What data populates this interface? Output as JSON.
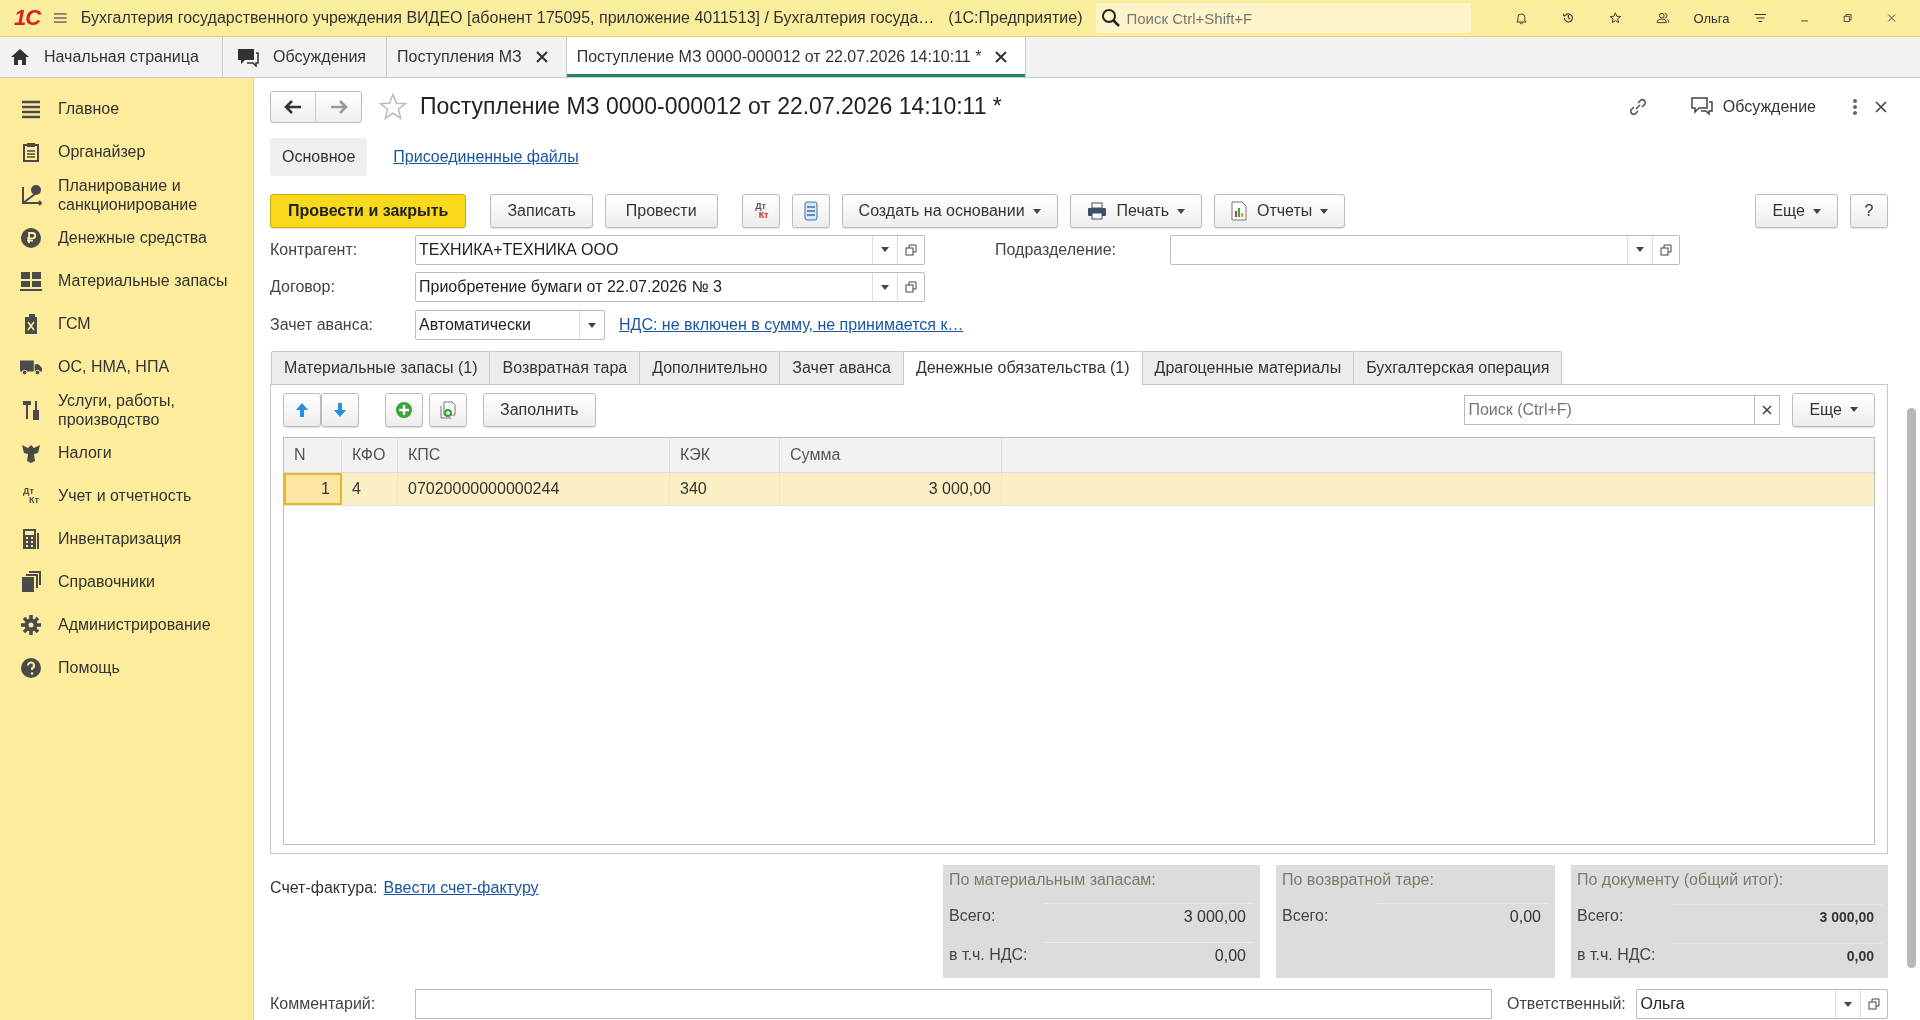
{
  "window": {
    "logo": "1С",
    "title": "Бухгалтерия государственного учреждения ВИДЕО [абонент 175095, приложение 4011513] / Бухгалтерия госуда…",
    "app_name": "(1С:Предприятие)",
    "search_placeholder": "Поиск Ctrl+Shift+F",
    "user": "Ольга"
  },
  "open_tabs": [
    {
      "label": "Начальная страница",
      "kind": "home",
      "selected": false,
      "closable": false
    },
    {
      "label": "Обсуждения",
      "kind": "discussions",
      "selected": false,
      "closable": false
    },
    {
      "label": "Поступления МЗ",
      "kind": "list",
      "selected": false,
      "closable": true
    },
    {
      "label": "Поступление МЗ 0000-000012 от 22.07.2026 14:10:11 *",
      "kind": "document",
      "selected": true,
      "closable": true
    }
  ],
  "sidebar": {
    "items": [
      {
        "label": "Главное"
      },
      {
        "label": "Органайзер"
      },
      {
        "label": "Планирование и санкционирование"
      },
      {
        "label": "Денежные средства"
      },
      {
        "label": "Материальные запасы"
      },
      {
        "label": "ГСМ"
      },
      {
        "label": "ОС, НМА, НПА"
      },
      {
        "label": "Услуги, работы, производство"
      },
      {
        "label": "Налоги"
      },
      {
        "label": "Учет и отчетность",
        "icon_text": [
          "Дт",
          "Кт"
        ]
      },
      {
        "label": "Инвентаризация"
      },
      {
        "label": "Справочники"
      },
      {
        "label": "Администрирование"
      },
      {
        "label": "Помощь"
      }
    ]
  },
  "document": {
    "title": "Поступление МЗ 0000-000012 от 22.07.2026 14:10:11 *",
    "favorite": false,
    "discussion": "Обсуждение",
    "form_tabs": [
      {
        "label": "Основное",
        "selected": true
      },
      {
        "label": "Присоединенные файлы",
        "selected": false
      }
    ],
    "toolbar": [
      {
        "label": "Провести и закрыть",
        "kind": "primary"
      },
      {
        "label": "Записать",
        "kind": "plain"
      },
      {
        "label": "Провести",
        "kind": "plain"
      },
      {
        "kind": "dtkt",
        "icon_text": [
          "Дт",
          "Кт"
        ]
      },
      {
        "kind": "list"
      },
      {
        "label": "Создать на основании",
        "kind": "dropdown"
      },
      {
        "label": "Печать",
        "kind": "print"
      },
      {
        "label": "Отчеты",
        "kind": "reports"
      }
    ],
    "toolbar_right": [
      {
        "label": "Еще",
        "kind": "dropdown"
      },
      {
        "label": "?",
        "kind": "plain"
      }
    ],
    "fields": {
      "counterparty": {
        "label": "Контрагент:",
        "value": "ТЕХНИКА+ТЕХНИКА ООО"
      },
      "department": {
        "label": "Подразделение:"
      },
      "contract": {
        "label": "Договор:",
        "value": "Приобретение бумаги от 22.07.2026 № 3"
      },
      "advance": {
        "label": "Зачет аванса:",
        "value": "Автоматически"
      },
      "vat_link": "НДС: не включен в сумму, не принимается к…"
    }
  },
  "tabs": [
    {
      "label": "Материальные запасы (1)",
      "selected": false
    },
    {
      "label": "Возвратная тара",
      "selected": false
    },
    {
      "label": "Дополнительно",
      "selected": false
    },
    {
      "label": "Зачет аванса",
      "selected": false
    },
    {
      "label": "Денежные обязательства (1)",
      "selected": true
    },
    {
      "label": "Драгоценные материалы",
      "selected": false
    },
    {
      "label": "Бухгалтерская операция",
      "selected": false
    }
  ],
  "table_toolbar": {
    "fill_button": "Заполнить",
    "search_placeholder": "Поиск (Ctrl+F)",
    "more": "Еще"
  },
  "table": {
    "columns": [
      "N",
      "КФО",
      "КПС",
      "КЭК",
      "Сумма"
    ],
    "rows": [
      {
        "cells": [
          "1",
          "4",
          "07020000000000244",
          "340",
          "3 000,00"
        ],
        "selected": true
      }
    ]
  },
  "invoice": {
    "label": "Счет-фактура:",
    "link": "Ввести счет-фактуру"
  },
  "totals": [
    {
      "title": "По материальным запасам:",
      "emphasized": false,
      "rows": [
        {
          "label": "Всего:",
          "value": "3 000,00"
        },
        {
          "label": "в т.ч. НДС:",
          "value": "0,00"
        }
      ]
    },
    {
      "title": "По возвратной таре:",
      "emphasized": false,
      "rows": [
        {
          "label": "Всего:",
          "value": "0,00"
        }
      ]
    },
    {
      "title": "По документу (общий итог):",
      "emphasized": true,
      "rows": [
        {
          "label": "Всего:",
          "value": "3 000,00"
        },
        {
          "label": "в т.ч. НДС:",
          "value": "0,00"
        }
      ]
    }
  ],
  "comment": {
    "label": "Комментарий:"
  },
  "responsible": {
    "label": "Ответственный:",
    "value": "Ольга"
  }
}
